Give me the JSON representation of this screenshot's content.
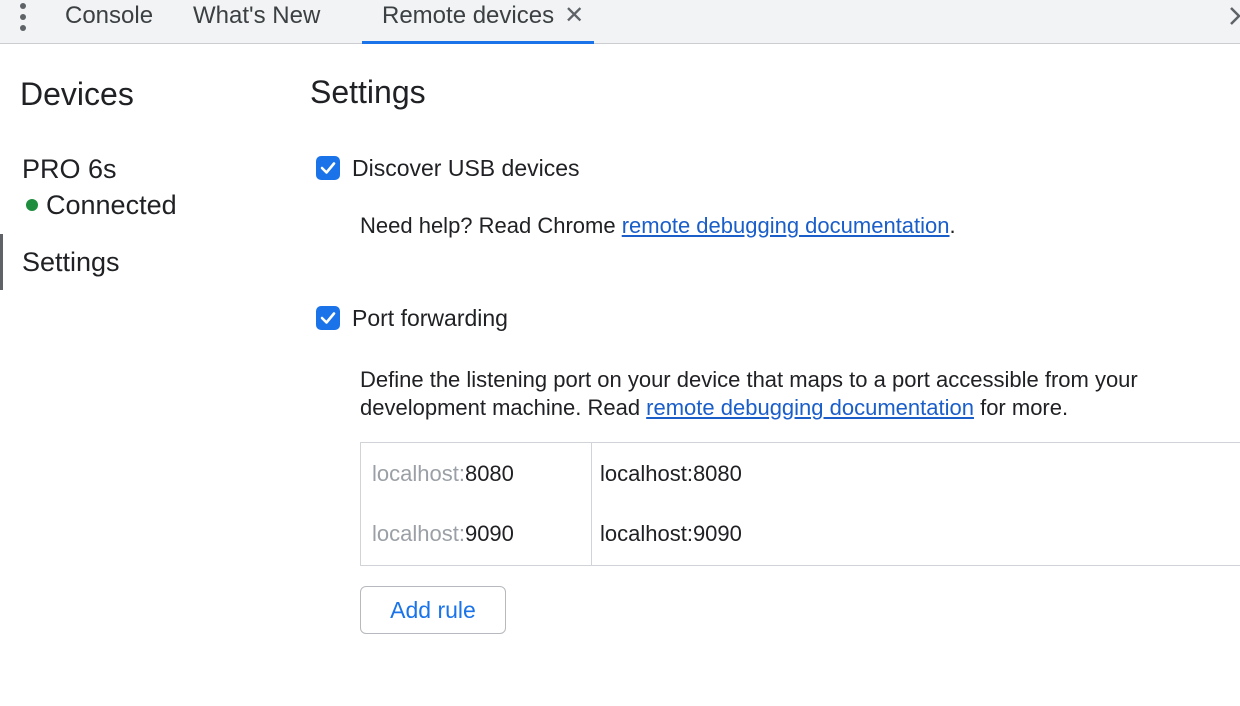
{
  "tabs": [
    {
      "label": "Console",
      "active": false
    },
    {
      "label": "What's New",
      "active": false
    },
    {
      "label": "Remote devices",
      "active": true,
      "close_glyph": "✕"
    }
  ],
  "overflow_icon": "chevron-right-icon",
  "colors": {
    "accent": "#1a73e8",
    "connected": "#1e8e3e",
    "link": "#1a5ec9",
    "muted_text": "#9aa0a6"
  },
  "sidebar": {
    "title": "Devices",
    "device": {
      "name": "PRO 6s",
      "status": "Connected"
    },
    "settings_label": "Settings"
  },
  "main": {
    "title": "Settings",
    "usb": {
      "label": "Discover USB devices",
      "checked": true,
      "help_prefix": "Need help? Read Chrome ",
      "help_link": "remote debugging documentation",
      "help_suffix": "."
    },
    "port_forwarding": {
      "label": "Port forwarding",
      "checked": true,
      "desc_prefix": "Define the listening port on your device that maps to a port accessible from your development machine. Read ",
      "desc_link": "remote debugging documentation",
      "desc_suffix": " for more.",
      "rules": [
        {
          "host_prefix": "localhost:",
          "port": "8080",
          "target": "localhost:8080"
        },
        {
          "host_prefix": "localhost:",
          "port": "9090",
          "target": "localhost:9090"
        }
      ],
      "add_rule_label": "Add rule"
    }
  }
}
